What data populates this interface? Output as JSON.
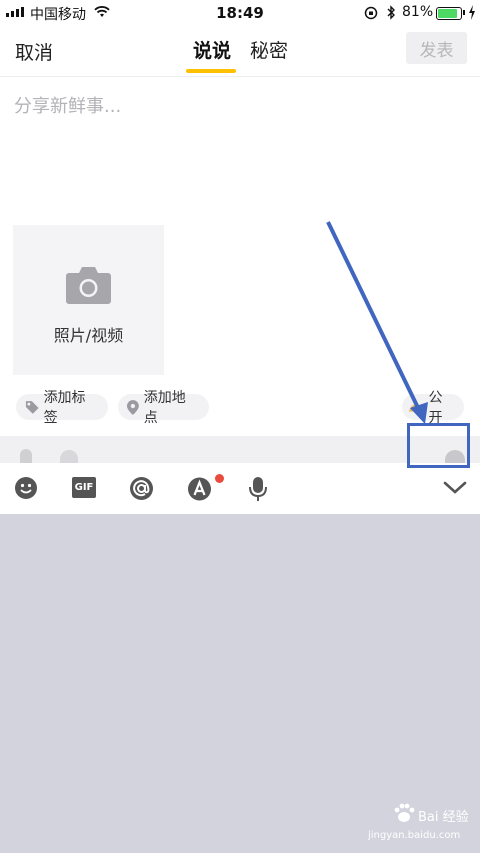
{
  "status_bar": {
    "carrier": "中国移动",
    "time": "18:49",
    "battery_percent": "81%",
    "battery_level": 0.81,
    "battery_color": "#4cd964"
  },
  "header": {
    "cancel_label": "取消",
    "tabs": [
      {
        "label": "说说",
        "active": true
      },
      {
        "label": "秘密",
        "active": false
      }
    ],
    "publish_label": "发表",
    "accent": "#ffc000"
  },
  "editor": {
    "placeholder": "分享新鲜事..."
  },
  "media": {
    "add_label": "照片/视频",
    "icon": "camera-icon"
  },
  "chips": {
    "tag_label": "添加标签",
    "location_label": "添加地点",
    "visibility_label": "公开"
  },
  "toolbar": {
    "items": [
      {
        "icon": "emoji-icon"
      },
      {
        "icon": "gif-icon",
        "text": "GIF"
      },
      {
        "icon": "at-icon"
      },
      {
        "icon": "font-style-icon",
        "badge": true
      },
      {
        "icon": "microphone-icon"
      },
      {
        "icon": "chevron-down-icon"
      }
    ],
    "badge_color": "#e94b3c"
  },
  "annotation": {
    "color": "#4166c0"
  },
  "watermark": {
    "text": "Bai 经验",
    "url_text": "jingyan.baidu.com"
  }
}
